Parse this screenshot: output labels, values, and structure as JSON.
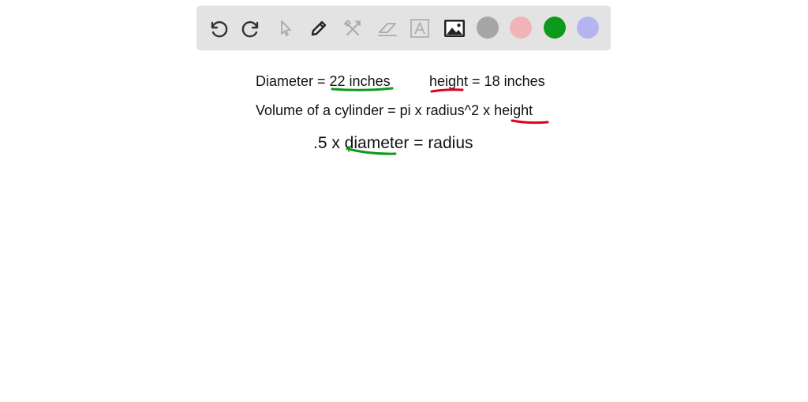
{
  "toolbar": {
    "tools": [
      {
        "name": "undo-icon"
      },
      {
        "name": "redo-icon"
      },
      {
        "name": "select-pointer-icon"
      },
      {
        "name": "pencil-icon"
      },
      {
        "name": "tools-icon"
      },
      {
        "name": "eraser-icon"
      },
      {
        "name": "text-box-icon"
      },
      {
        "name": "image-icon"
      }
    ],
    "colors": [
      "#a6a6a6",
      "#f0b4b8",
      "#0d9a1b",
      "#b4b4f0"
    ]
  },
  "notes": {
    "line1_a": "Diameter = 22 inches",
    "line1_b": "height = 18 inches",
    "line2": "Volume of a cylinder = pi x radius^2 x height",
    "line3": ".5 x diameter = radius"
  },
  "ink_colors": {
    "green": "#0d9a1b",
    "red": "#e0001a"
  }
}
